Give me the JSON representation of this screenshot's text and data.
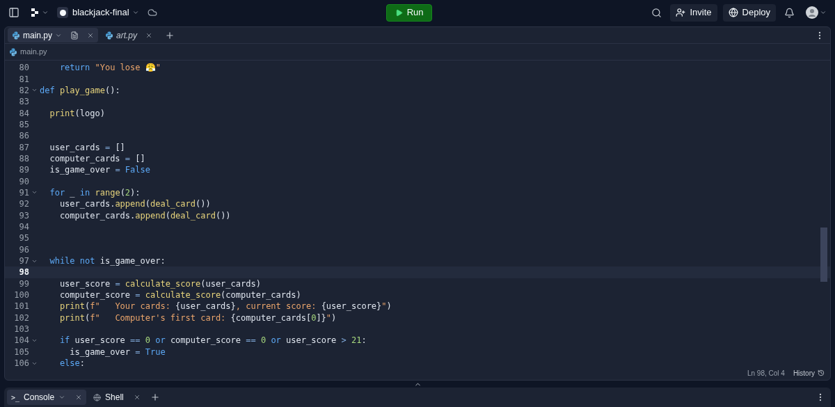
{
  "topbar": {
    "project": "blackjack-final",
    "run": "Run",
    "invite": "Invite",
    "deploy": "Deploy"
  },
  "editor_tabs": [
    {
      "label": "main.py",
      "selected": true,
      "italic": false
    },
    {
      "label": "art.py",
      "selected": false,
      "italic": true
    }
  ],
  "breadcrumb": "main.py",
  "code": [
    {
      "number": "80",
      "fold": false,
      "current": false,
      "tokens": [
        {
          "kind": "keyword",
          "text": "    return"
        },
        {
          "kind": "string",
          "text": " \"You lose 😤\""
        }
      ]
    },
    {
      "number": "81",
      "fold": false,
      "current": false
    },
    {
      "number": "82",
      "fold": true,
      "current": false,
      "tokens": [
        {
          "kind": "keyword",
          "text": "def"
        },
        {
          "kind": "function",
          "text": " play_game"
        },
        {
          "kind": "plain",
          "text": "():"
        }
      ]
    },
    {
      "number": "83",
      "fold": false,
      "current": false
    },
    {
      "number": "84",
      "fold": false,
      "current": false,
      "tokens": [
        {
          "kind": "function",
          "text": "  print"
        },
        {
          "kind": "plain",
          "text": "(logo)"
        }
      ]
    },
    {
      "number": "85",
      "fold": false,
      "current": false
    },
    {
      "number": "86",
      "fold": false,
      "current": false
    },
    {
      "number": "87",
      "fold": false,
      "current": false,
      "tokens": [
        {
          "kind": "plain",
          "text": "  user_cards "
        },
        {
          "kind": "operator",
          "text": "="
        },
        {
          "kind": "plain",
          "text": " []"
        }
      ]
    },
    {
      "number": "88",
      "fold": false,
      "current": false,
      "tokens": [
        {
          "kind": "plain",
          "text": "  computer_cards "
        },
        {
          "kind": "operator",
          "text": "="
        },
        {
          "kind": "plain",
          "text": " []"
        }
      ]
    },
    {
      "number": "89",
      "fold": false,
      "current": false,
      "tokens": [
        {
          "kind": "plain",
          "text": "  is_game_over "
        },
        {
          "kind": "operator",
          "text": "="
        },
        {
          "kind": "keyword",
          "text": " False"
        }
      ]
    },
    {
      "number": "90",
      "fold": false,
      "current": false
    },
    {
      "number": "91",
      "fold": true,
      "current": false,
      "tokens": [
        {
          "kind": "keyword",
          "text": "  for"
        },
        {
          "kind": "plain",
          "text": " _ "
        },
        {
          "kind": "keyword",
          "text": "in"
        },
        {
          "kind": "function",
          "text": " range"
        },
        {
          "kind": "plain",
          "text": "("
        },
        {
          "kind": "number",
          "text": "2"
        },
        {
          "kind": "plain",
          "text": "):"
        }
      ]
    },
    {
      "number": "92",
      "fold": false,
      "current": false,
      "tokens": [
        {
          "kind": "plain",
          "text": "    user_cards."
        },
        {
          "kind": "function",
          "text": "append"
        },
        {
          "kind": "plain",
          "text": "("
        },
        {
          "kind": "function",
          "text": "deal_card"
        },
        {
          "kind": "plain",
          "text": "())"
        }
      ]
    },
    {
      "number": "93",
      "fold": false,
      "current": false,
      "tokens": [
        {
          "kind": "plain",
          "text": "    computer_cards."
        },
        {
          "kind": "function",
          "text": "append"
        },
        {
          "kind": "plain",
          "text": "("
        },
        {
          "kind": "function",
          "text": "deal_card"
        },
        {
          "kind": "plain",
          "text": "())"
        }
      ]
    },
    {
      "number": "94",
      "fold": false,
      "current": false
    },
    {
      "number": "95",
      "fold": false,
      "current": false
    },
    {
      "number": "96",
      "fold": false,
      "current": false
    },
    {
      "number": "97",
      "fold": true,
      "current": false,
      "tokens": [
        {
          "kind": "keyword",
          "text": "  while"
        },
        {
          "kind": "keyword",
          "text": " not"
        },
        {
          "kind": "plain",
          "text": " is_game_over:"
        }
      ]
    },
    {
      "number": "98",
      "fold": false,
      "current": true
    },
    {
      "number": "99",
      "fold": false,
      "current": false,
      "tokens": [
        {
          "kind": "plain",
          "text": "    user_score "
        },
        {
          "kind": "operator",
          "text": "="
        },
        {
          "kind": "function",
          "text": " calculate_score"
        },
        {
          "kind": "plain",
          "text": "(user_cards)"
        }
      ]
    },
    {
      "number": "100",
      "fold": false,
      "current": false,
      "tokens": [
        {
          "kind": "plain",
          "text": "    computer_score "
        },
        {
          "kind": "operator",
          "text": "="
        },
        {
          "kind": "function",
          "text": " calculate_score"
        },
        {
          "kind": "plain",
          "text": "(computer_cards)"
        }
      ]
    },
    {
      "number": "101",
      "fold": false,
      "current": false,
      "tokens": [
        {
          "kind": "function",
          "text": "    print"
        },
        {
          "kind": "plain",
          "text": "("
        },
        {
          "kind": "string",
          "text": "f\"   Your cards: "
        },
        {
          "kind": "plain",
          "text": "{user_cards}"
        },
        {
          "kind": "string",
          "text": ", current score: "
        },
        {
          "kind": "plain",
          "text": "{user_score}"
        },
        {
          "kind": "string",
          "text": "\""
        },
        {
          "kind": "plain",
          "text": ")"
        }
      ]
    },
    {
      "number": "102",
      "fold": false,
      "current": false,
      "tokens": [
        {
          "kind": "function",
          "text": "    print"
        },
        {
          "kind": "plain",
          "text": "("
        },
        {
          "kind": "string",
          "text": "f\"   Computer's first card: "
        },
        {
          "kind": "plain",
          "text": "{computer_cards["
        },
        {
          "kind": "number",
          "text": "0"
        },
        {
          "kind": "plain",
          "text": "]}"
        },
        {
          "kind": "string",
          "text": "\""
        },
        {
          "kind": "plain",
          "text": ")"
        }
      ]
    },
    {
      "number": "103",
      "fold": false,
      "current": false
    },
    {
      "number": "104",
      "fold": true,
      "current": false,
      "tokens": [
        {
          "kind": "keyword",
          "text": "    if"
        },
        {
          "kind": "plain",
          "text": " user_score "
        },
        {
          "kind": "operator",
          "text": "=="
        },
        {
          "kind": "number",
          "text": " 0"
        },
        {
          "kind": "keyword",
          "text": " or"
        },
        {
          "kind": "plain",
          "text": " computer_score "
        },
        {
          "kind": "operator",
          "text": "=="
        },
        {
          "kind": "number",
          "text": " 0"
        },
        {
          "kind": "keyword",
          "text": " or"
        },
        {
          "kind": "plain",
          "text": " user_score "
        },
        {
          "kind": "operator",
          "text": ">"
        },
        {
          "kind": "number",
          "text": " 21"
        },
        {
          "kind": "plain",
          "text": ":"
        }
      ]
    },
    {
      "number": "105",
      "fold": false,
      "current": false,
      "tokens": [
        {
          "kind": "plain",
          "text": "      is_game_over "
        },
        {
          "kind": "operator",
          "text": "="
        },
        {
          "kind": "keyword",
          "text": " True"
        }
      ]
    },
    {
      "number": "106",
      "fold": true,
      "current": false,
      "tokens": [
        {
          "kind": "keyword",
          "text": "    else"
        },
        {
          "kind": "plain",
          "text": ":"
        }
      ]
    }
  ],
  "status": {
    "position": "Ln 98, Col 4",
    "history": "History"
  },
  "bottom_tabs": [
    {
      "label": "Console",
      "selected": true,
      "prompt": ">_"
    },
    {
      "label": "Shell",
      "selected": false
    }
  ]
}
